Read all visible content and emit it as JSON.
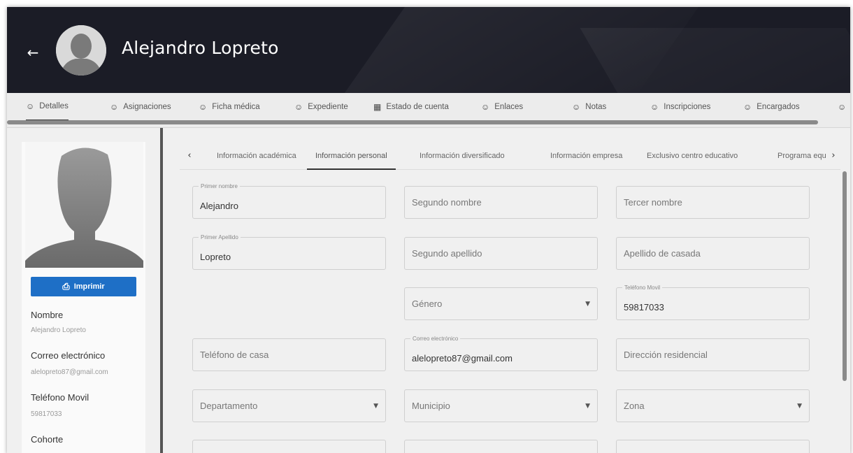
{
  "header": {
    "title": "Alejandro Lopreto",
    "back_icon": "arrow-left-icon"
  },
  "main_tabs": [
    {
      "label": "Detalles",
      "icon": "user-icon"
    },
    {
      "label": "Asignaciones",
      "icon": "user-icon"
    },
    {
      "label": "Ficha médica",
      "icon": "user-icon"
    },
    {
      "label": "Expediente",
      "icon": "user-icon"
    },
    {
      "label": "Estado de cuenta",
      "icon": "grid-icon"
    },
    {
      "label": "Enlaces",
      "icon": "user-icon"
    },
    {
      "label": "Notas",
      "icon": "user-icon"
    },
    {
      "label": "Inscripciones",
      "icon": "user-icon"
    },
    {
      "label": "Encargados",
      "icon": "user-icon"
    }
  ],
  "sidebar": {
    "print_label": "Imprimir",
    "fields": [
      {
        "label": "Nombre",
        "value": "Alejandro Lopreto"
      },
      {
        "label": "Correo electrónico",
        "value": "alelopreto87@gmail.com"
      },
      {
        "label": "Teléfono Movil",
        "value": "59817033"
      },
      {
        "label": "Cohorte",
        "value": ""
      }
    ]
  },
  "sub_tabs": [
    {
      "label": "Información académica"
    },
    {
      "label": "Información personal"
    },
    {
      "label": "Información diversificado"
    },
    {
      "label": "Información empresa"
    },
    {
      "label": "Exclusivo centro educativo"
    },
    {
      "label": "Programa equivalencia"
    }
  ],
  "form": {
    "primer_nombre": {
      "label": "Primer nombre",
      "value": "Alejandro"
    },
    "segundo_nombre": {
      "placeholder": "Segundo nombre"
    },
    "tercer_nombre": {
      "placeholder": "Tercer nombre"
    },
    "primer_apellido": {
      "label": "Primer Apellido",
      "value": "Lopreto"
    },
    "segundo_apellido": {
      "placeholder": "Segundo apellido"
    },
    "apellido_casada": {
      "placeholder": "Apellido de casada"
    },
    "genero": {
      "placeholder": "Género"
    },
    "telefono_movil": {
      "label": "Teléfono Movil",
      "value": "59817033"
    },
    "telefono_casa": {
      "placeholder": "Teléfono de casa"
    },
    "correo": {
      "label": "Correo electrónico",
      "value": "alelopreto87@gmail.com"
    },
    "direccion": {
      "placeholder": "Dirección residencial"
    },
    "departamento": {
      "placeholder": "Departamento"
    },
    "municipio": {
      "placeholder": "Municipio"
    },
    "zona": {
      "placeholder": "Zona"
    }
  },
  "colors": {
    "header_bg": "#1b1c26",
    "accent": "#1e6fc6",
    "panel_bg": "#f0f0f0"
  }
}
